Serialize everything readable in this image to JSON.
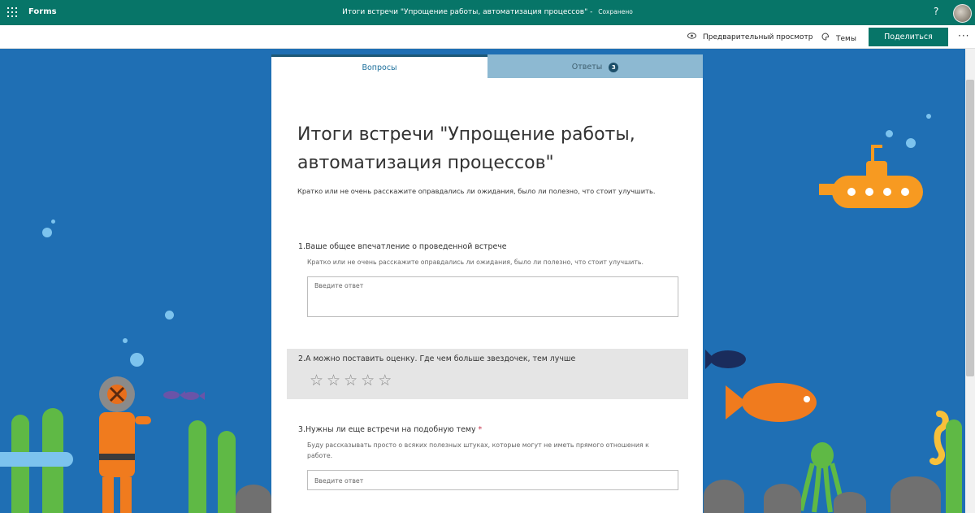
{
  "app": {
    "name": "Forms",
    "document_title": "Итоги встречи \"Упрощение работы, автоматизация процессов\"",
    "separator": " - ",
    "save_status": "Сохранено",
    "help": "?"
  },
  "toolbar": {
    "preview_label": "Предварительный просмотр",
    "themes_label": "Темы",
    "share_label": "Поделиться",
    "more": "···"
  },
  "tabs": [
    {
      "label": "Вопросы",
      "active": true
    },
    {
      "label": "Ответы",
      "count": "3",
      "active": false
    }
  ],
  "form": {
    "title": "Итоги встречи \"Упрощение работы, автоматизация процессов\"",
    "description": "Кратко или не очень расскажите оправдались ли ожидания, было ли полезно, что стоит улучшить.",
    "questions": [
      {
        "number": "1.",
        "text": "Ваше общее впечатление о проведенной встрече",
        "subtitle": "Кратко или не очень расскажите оправдались ли ожидания, было ли полезно, что стоит улучшить.",
        "placeholder": "Введите ответ",
        "required": false
      },
      {
        "number": "2.",
        "text": "А можно поставить оценку. Где чем больше звездочек, тем лучше",
        "rating_max": 5,
        "rating_value": 0,
        "star": "☆"
      },
      {
        "number": "3.",
        "text": "Нужны ли еще встречи на подобную тему",
        "required_mark": "*",
        "subtitle": "Буду рассказывать просто о всяких полезных штуках, которые могут не иметь прямого отношения к работе.",
        "placeholder": "Введите ответ",
        "required": true
      }
    ]
  },
  "colors": {
    "brand": "#077568",
    "ocean": "#1f6fb4",
    "tab_inactive": "#8db9d2",
    "required": "#c4314b"
  },
  "icons": [
    "waffle-icon",
    "eye-icon",
    "palette-icon",
    "more-icon"
  ]
}
